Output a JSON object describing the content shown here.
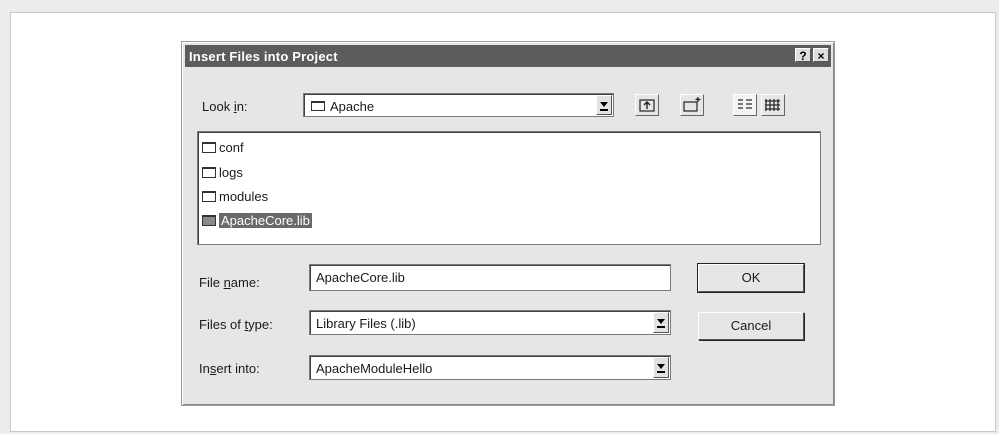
{
  "dialog": {
    "title": "Insert Files into Project",
    "help_glyph": "?",
    "close_glyph": "×"
  },
  "lookin": {
    "label_before": "Look ",
    "label_mnemonic": "i",
    "label_after": "n:",
    "value": "Apache"
  },
  "toolbar": {
    "icons": [
      "up-one-level-icon",
      "create-new-folder-icon",
      "list-view-icon",
      "details-view-icon"
    ]
  },
  "files": [
    {
      "name": "conf",
      "type": "folder"
    },
    {
      "name": "logs",
      "type": "folder"
    },
    {
      "name": "modules",
      "type": "folder"
    },
    {
      "name": "ApacheCore.lib",
      "type": "file",
      "selected": true
    }
  ],
  "filename": {
    "label_before": "File ",
    "label_mnemonic": "n",
    "label_after": "ame:",
    "value": "ApacheCore.lib"
  },
  "filetype": {
    "label_before": "Files of ",
    "label_mnemonic": "t",
    "label_after": "ype:",
    "value": "Library Files (.lib)"
  },
  "insertinto": {
    "label_before": "In",
    "label_mnemonic": "s",
    "label_after": "ert into:",
    "value": "ApacheModuleHello"
  },
  "buttons": {
    "ok": "OK",
    "cancel": "Cancel"
  }
}
